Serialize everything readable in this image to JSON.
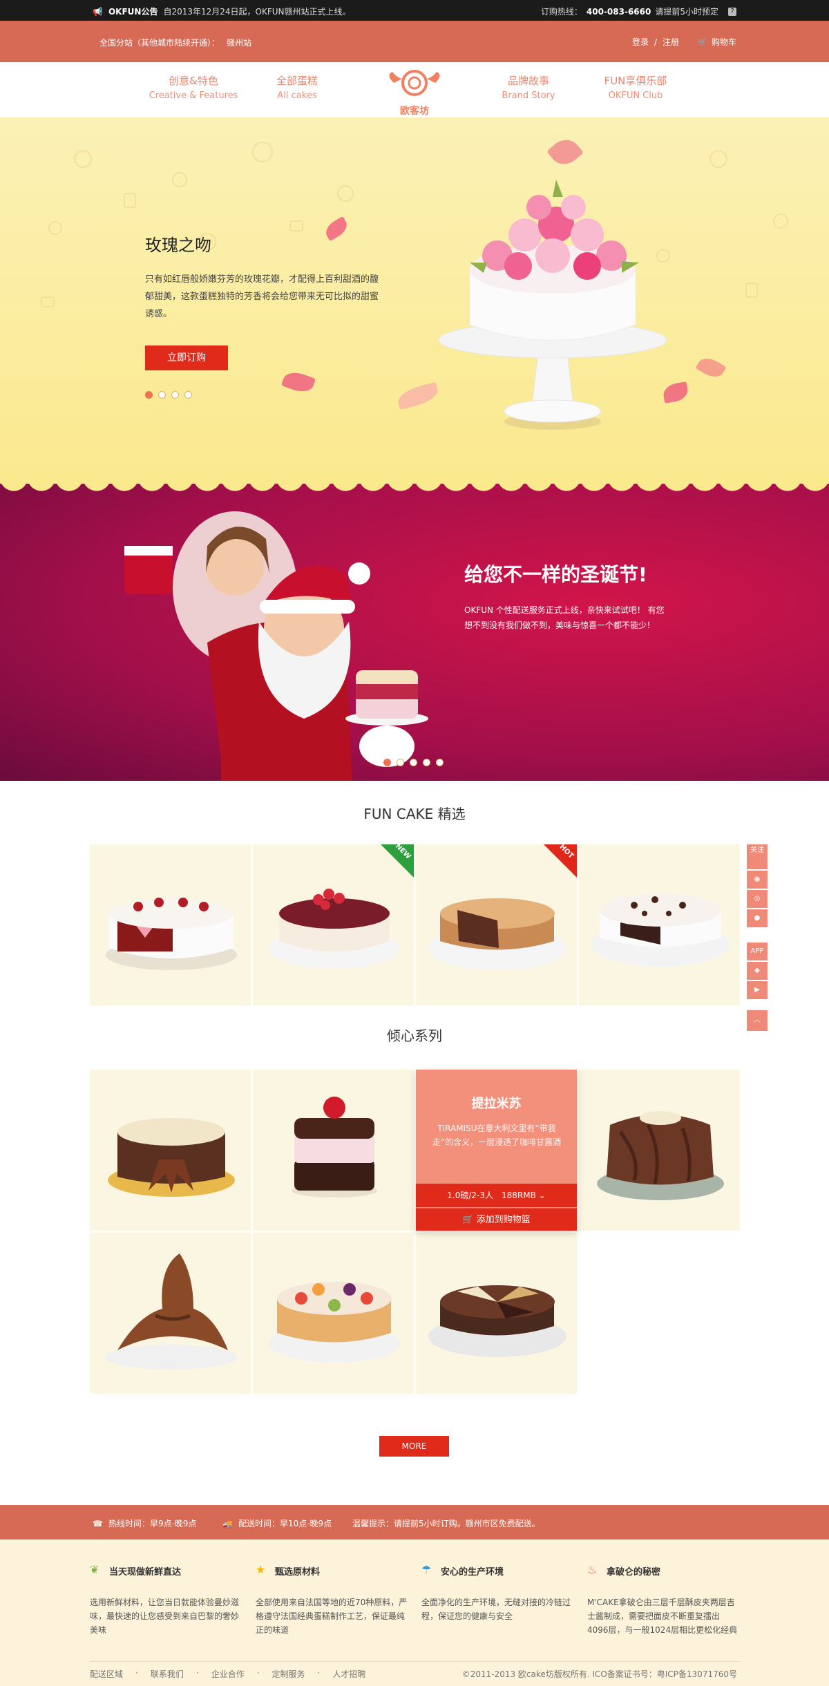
{
  "topbar": {
    "brand": "OKFUN公告",
    "notice": "自2013年12月24日起，OKFUN赣州站正式上线。",
    "hotline_label": "订购热线：",
    "hotline": "400-083-6660",
    "hotline_note": "请提前5小时预定",
    "help_icon": "?"
  },
  "header": {
    "city_label": "全国分站（其他城市陆续开通）：",
    "city": "赣州站",
    "login": "登录",
    "sep": "/",
    "register": "注册",
    "cart": "购物车"
  },
  "nav": {
    "items": [
      {
        "zh": "创意&特色",
        "en": "Creative & Features"
      },
      {
        "zh": "全部蛋糕",
        "en": "All cakes"
      },
      {
        "zh": "品牌故事",
        "en": "Brand Story"
      },
      {
        "zh": "FUN享俱乐部",
        "en": "OKFUN Club"
      }
    ],
    "logo_text": "欧客坊"
  },
  "hero1": {
    "title": "玫瑰之吻",
    "desc": "只有如红唇般娇嫩芬芳的玫瑰花瓣，才配得上百利甜酒的馥郁甜美，这款蛋糕独特的芳香将会给您带来无可比拟的甜蜜诱惑。",
    "button": "立即订购",
    "slides": 4,
    "active": 0
  },
  "hero2": {
    "title": "给您不一样的圣诞节!",
    "desc": "OKFUN 个性配送服务正式上线，亲快来试试吧！ 有您想不到没有我们做不到，美味与惊喜一个都不能少！",
    "slides": 5,
    "active": 0
  },
  "section1": {
    "title": "FUN CAKE 精选",
    "products": [
      {
        "name": "red-velvet-heart-cake",
        "badge": ""
      },
      {
        "name": "cherry-cream-cake",
        "badge": "NEW",
        "badge_color": "#2e9e3e"
      },
      {
        "name": "chestnut-tart-cake",
        "badge": "HOT",
        "badge_color": "#e0281a"
      },
      {
        "name": "chocolate-chip-cake",
        "badge": ""
      }
    ]
  },
  "section2": {
    "title": "倾心系列",
    "hover": {
      "name": "提拉米苏",
      "desc": "TIRAMISU在意大利文里有“带我走”的含义，一层浸透了咖啡甘露酒",
      "option": "1.0磅/2-3人　188RMB",
      "add": "添加到购物篮"
    }
  },
  "more": "MORE",
  "sidebar": {
    "follow": "关注",
    "app": "APP"
  },
  "infobar": {
    "hotline": "热线时间：早9点-晚9点",
    "delivery": "配送时间：早10点-晚9点",
    "tip": "温馨提示：请提前5小时订购。赣州市区免费配送。"
  },
  "footer": {
    "features": [
      {
        "title": "当天现做新鲜直达",
        "desc": "选用新鲜材料，让您当日就能体验曼妙滋味，最快速的让您感受到来自巴黎的奢妙美味"
      },
      {
        "title": "甄选原材料",
        "desc": "全部使用来自法国等地的近70种原料，严格遵守法国经典蛋糕制作工艺，保证最纯正的味道"
      },
      {
        "title": "安心的生产环境",
        "desc": "全面净化的生产环境，无缝对接的冷链过程，保证您的健康与安全"
      },
      {
        "title": "拿破仑的秘密",
        "desc": "M'CAKE拿破仑由三层千层酥皮夹两层吉士酱制成，需要把面皮不断重复擂出4096层，与一般1024层相比更松化经典"
      }
    ],
    "links": [
      "配送区域",
      "联系我们",
      "企业合作",
      "定制服务",
      "人才招聘"
    ],
    "copyright": "©2011-2013 欧cake坊版权所有. ICO备案证书号：粤ICP备13071760号"
  },
  "colors": {
    "primary": "#d66a54",
    "accent_red": "#e02a1a",
    "cream": "#fbf6e2",
    "nav_text": "#e6856e"
  }
}
